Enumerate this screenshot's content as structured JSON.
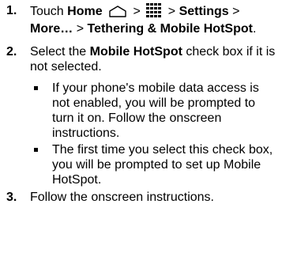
{
  "steps": [
    {
      "number": "1.",
      "parts": {
        "touch": "Touch",
        "home": "Home",
        "gt1": ">",
        "gt2": ">",
        "settings": "Settings",
        "gt3": ">",
        "more": "More…",
        "gt4": ">",
        "tethering": "Tethering & Mobile HotSpot",
        "end": "."
      },
      "icons": [
        "home-icon",
        "apps-grid-icon"
      ]
    },
    {
      "number": "2.",
      "parts": {
        "select": "Select the",
        "item": "Mobile HotSpot",
        "rest": "check box if it is not selected."
      },
      "bullets": [
        "If your phone's mobile data access is not enabled, you will be prompted to turn it on. Follow the onscreen instructions.",
        "The first time you select this check box, you will be prompted to set up Mobile HotSpot."
      ]
    },
    {
      "number": "3.",
      "text": "Follow the onscreen instructions."
    }
  ]
}
